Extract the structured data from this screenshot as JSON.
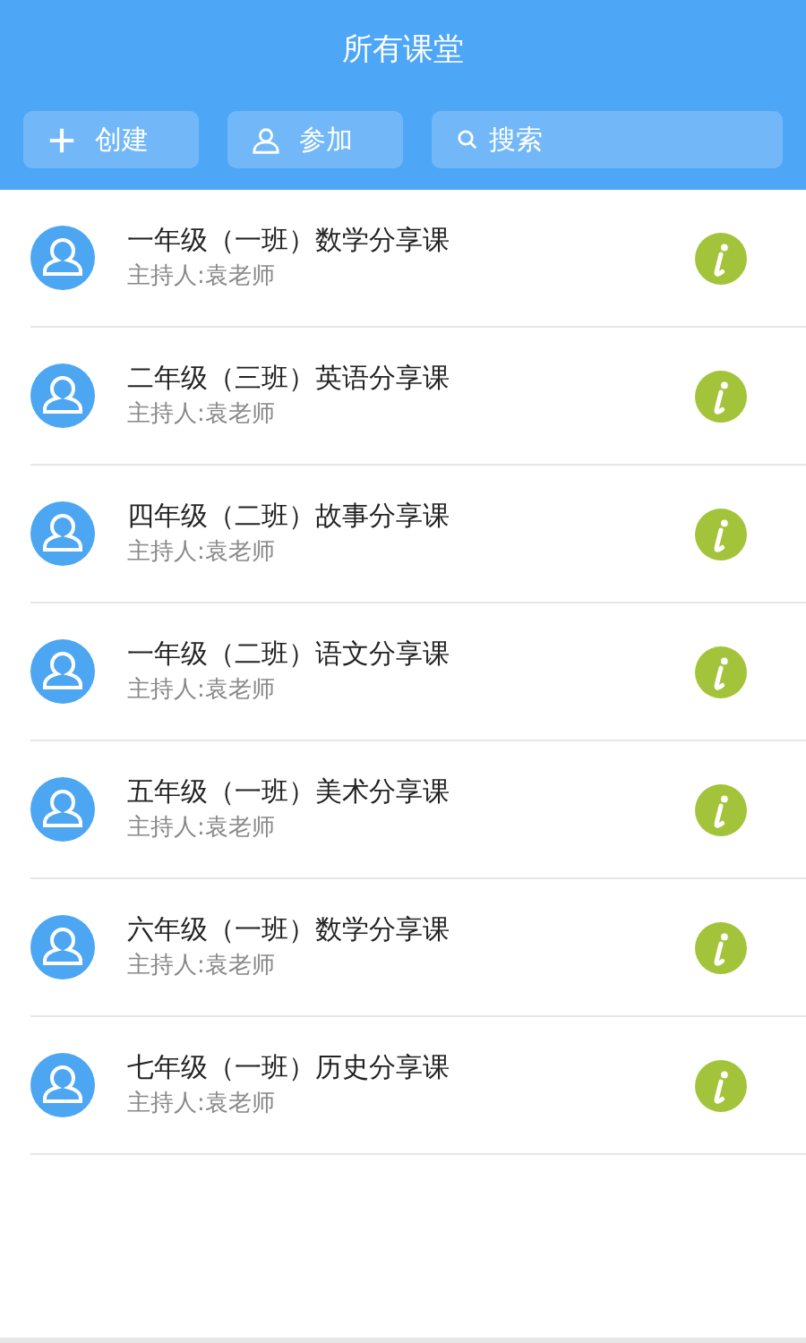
{
  "header": {
    "title": "所有课堂"
  },
  "toolbar": {
    "create_button": "创建",
    "join_button": "参加",
    "search": {
      "placeholder": "搜索"
    }
  },
  "classes": [
    {
      "title": "一年级（一班）数学分享课",
      "host": "主持人:袁老师"
    },
    {
      "title": "二年级（三班）英语分享课",
      "host": "主持人:袁老师"
    },
    {
      "title": "四年级（二班）故事分享课",
      "host": "主持人:袁老师"
    },
    {
      "title": "一年级（二班）语文分享课",
      "host": "主持人:袁老师"
    },
    {
      "title": "五年级（一班）美术分享课",
      "host": "主持人:袁老师"
    },
    {
      "title": "六年级（一班）数学分享课",
      "host": "主持人:袁老师"
    },
    {
      "title": "七年级（一班）历史分享课",
      "host": "主持人:袁老师"
    }
  ]
}
